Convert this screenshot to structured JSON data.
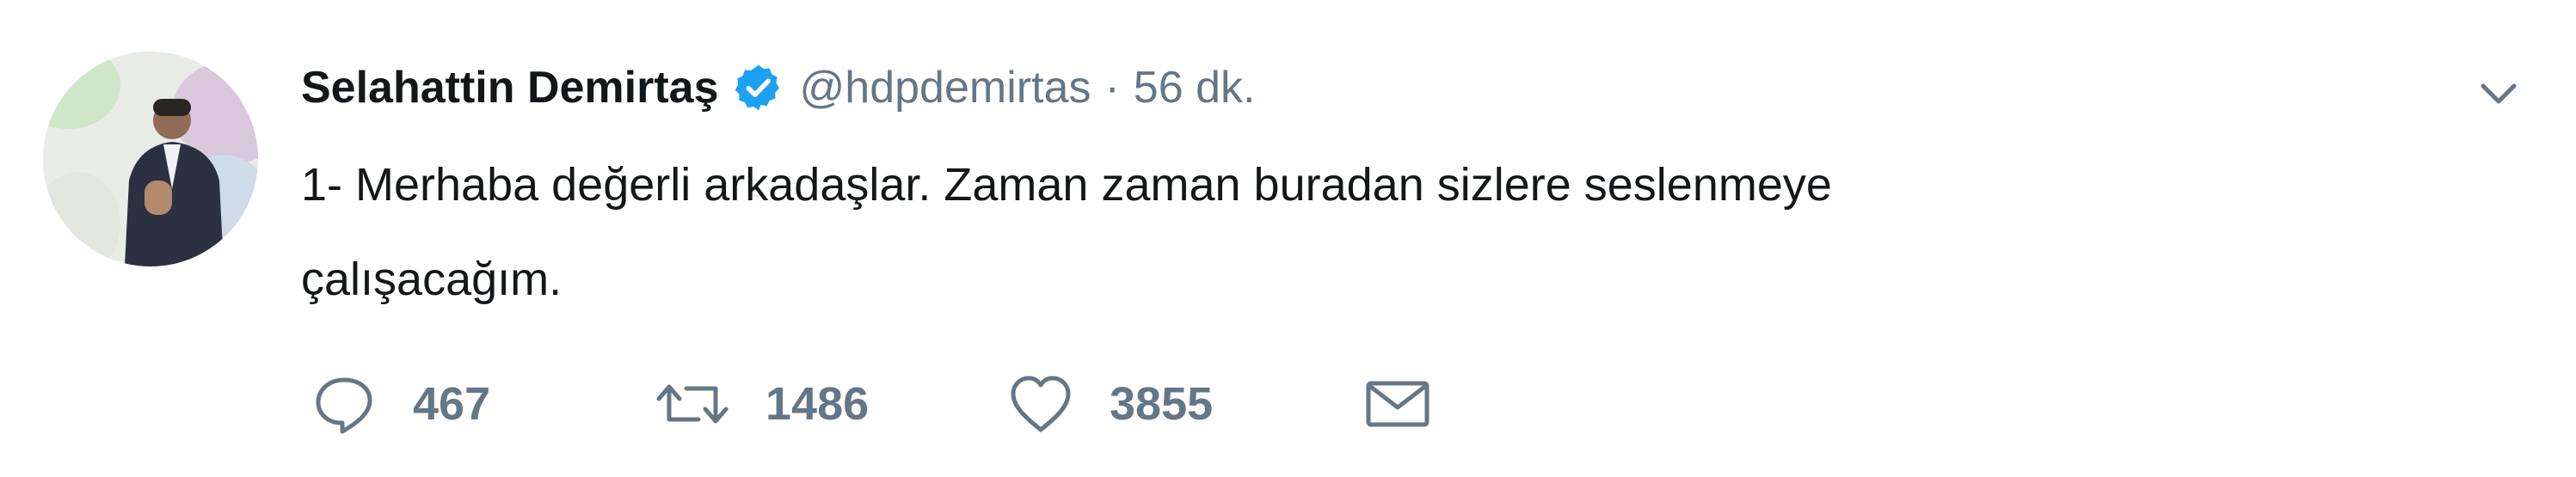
{
  "tweet": {
    "author_name": "Selahattin Demirtaş",
    "handle": "@hdpdemirtas",
    "separator": "·",
    "time": "56 dk.",
    "text_line1": "1- Merhaba değerli arkadaşlar. Zaman zaman buradan sizlere seslenmeye",
    "text_line2": "çalışacağım.",
    "verified_color": "#1da1f2"
  },
  "actions": {
    "reply_count": "467",
    "retweet_count": "1486",
    "like_count": "3855"
  },
  "icons": {
    "reply": "reply-icon",
    "retweet": "retweet-icon",
    "like": "heart-icon",
    "message": "envelope-icon",
    "menu": "chevron-down-icon",
    "verified": "verified-badge-icon"
  },
  "colors": {
    "text": "#14171a",
    "secondary": "#657786",
    "background": "#ffffff"
  }
}
